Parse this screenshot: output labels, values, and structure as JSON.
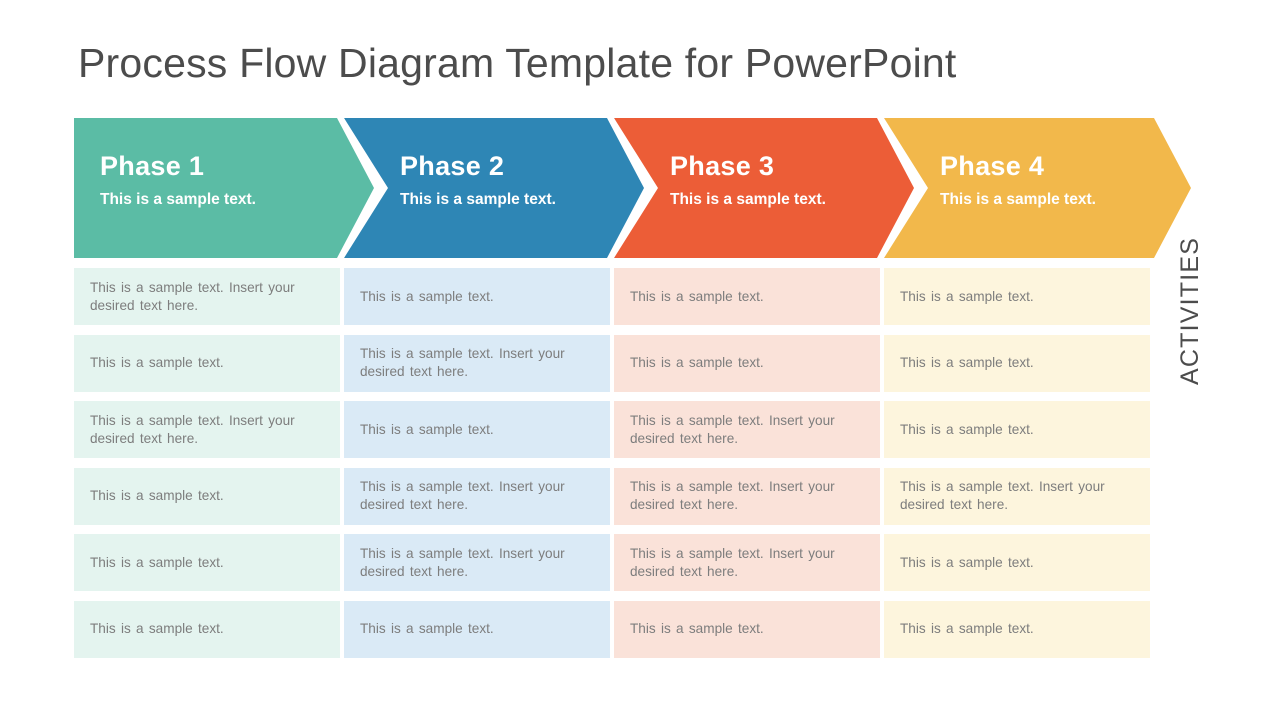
{
  "slide": {
    "title": "Process Flow Diagram Template for PowerPoint",
    "side_label": "ACTIVITIES",
    "background": "#ffffff",
    "title_color": "#4c4c4c"
  },
  "phases": [
    {
      "title": "Phase 1",
      "subtitle": "This is a sample text.",
      "color": "#5bbca5",
      "cell_color": "#e4f4ef"
    },
    {
      "title": "Phase 2",
      "subtitle": "This is a sample text.",
      "color": "#2e86b5",
      "cell_color": "#daeaf6"
    },
    {
      "title": "Phase 3",
      "subtitle": "This is a sample text.",
      "color": "#ec5d37",
      "cell_color": "#fae2d9"
    },
    {
      "title": "Phase 4",
      "subtitle": "This is a sample text.",
      "color": "#f2b84b",
      "cell_color": "#fdf5dd"
    }
  ],
  "activities": {
    "short_text": "This  is a sample  text.",
    "long_text": "This  is a sample  text.  Insert your  desired  text  here.",
    "columns": [
      {
        "phase": "Phase 1",
        "rows": [
          "This  is a sample  text.  Insert your  desired  text  here.",
          "This  is a sample  text.",
          "This  is a sample  text.  Insert your  desired  text  here.",
          "This  is a sample  text.",
          "This  is a sample  text.",
          "This  is a sample  text."
        ]
      },
      {
        "phase": "Phase 2",
        "rows": [
          "This  is a sample  text.",
          "This  is a sample  text.  Insert your  desired  text  here.",
          "This  is a sample  text.",
          "This  is a sample  text.  Insert your  desired  text  here.",
          "This  is a sample  text.  Insert your  desired  text  here.",
          "This  is a sample  text."
        ]
      },
      {
        "phase": "Phase 3",
        "rows": [
          "This  is a sample  text.",
          "This  is a sample  text.",
          "This  is a sample  text.  Insert your  desired  text  here.",
          "This  is a sample  text.  Insert your  desired  text  here.",
          "This  is a sample  text.  Insert your  desired  text  here.",
          "This  is a sample  text."
        ]
      },
      {
        "phase": "Phase 4",
        "rows": [
          "This  is a sample  text.",
          "This  is a sample  text.",
          "This  is a sample  text.",
          "This  is a sample  text.  Insert your  desired  text  here.",
          "This  is a sample  text.",
          "This  is a sample  text."
        ]
      }
    ]
  }
}
